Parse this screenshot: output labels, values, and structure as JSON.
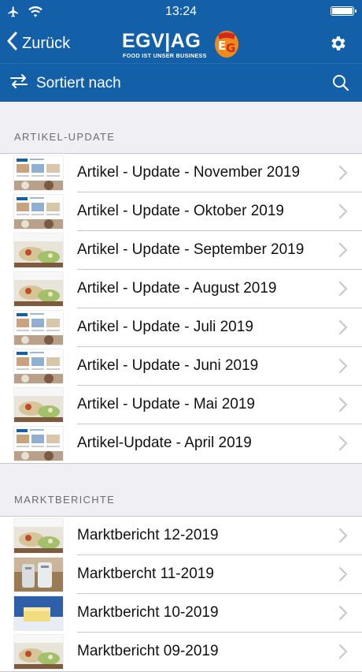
{
  "status_bar": {
    "time": "13:24",
    "icons": [
      "airplane-icon",
      "wifi-icon",
      "battery-icon"
    ]
  },
  "nav": {
    "back_label": "Zurück",
    "logo_text": "EGV|AG",
    "logo_tagline": "FOOD IST UNSER BUSINESS",
    "logo_mark": "EG",
    "icons": [
      "chevron-left-icon",
      "gear-icon"
    ]
  },
  "toolbar": {
    "sort_label": "Sortiert nach",
    "icons": [
      "sort-arrows-icon",
      "search-icon"
    ]
  },
  "sections": [
    {
      "header": "ARTIKEL-UPDATE",
      "items": [
        {
          "label": "Artikel - Update - November 2019",
          "thumb": "catalog"
        },
        {
          "label": "Artikel - Update - Oktober 2019",
          "thumb": "catalog"
        },
        {
          "label": "Artikel - Update - September 2019",
          "thumb": "food"
        },
        {
          "label": "Artikel - Update - August 2019",
          "thumb": "food"
        },
        {
          "label": "Artikel - Update - Juli 2019",
          "thumb": "catalog"
        },
        {
          "label": "Artikel - Update - Juni 2019",
          "thumb": "catalog"
        },
        {
          "label": "Artikel - Update - Mai 2019",
          "thumb": "food"
        },
        {
          "label": "Artikel-Update - April 2019",
          "thumb": "catalog"
        }
      ]
    },
    {
      "header": "MARKTBERICHTE",
      "items": [
        {
          "label": "Marktbericht 12-2019",
          "thumb": "food"
        },
        {
          "label": "Marktbercht 11-2019",
          "thumb": "milk"
        },
        {
          "label": "Marktbericht 10-2019",
          "thumb": "butter"
        },
        {
          "label": "Marktbericht 09-2019",
          "thumb": "food"
        }
      ]
    }
  ],
  "colors": {
    "brand_blue": "#1460a8",
    "background": "#f0eff4",
    "logo_orange": "#f08a1c",
    "logo_red": "#d42a1e"
  }
}
